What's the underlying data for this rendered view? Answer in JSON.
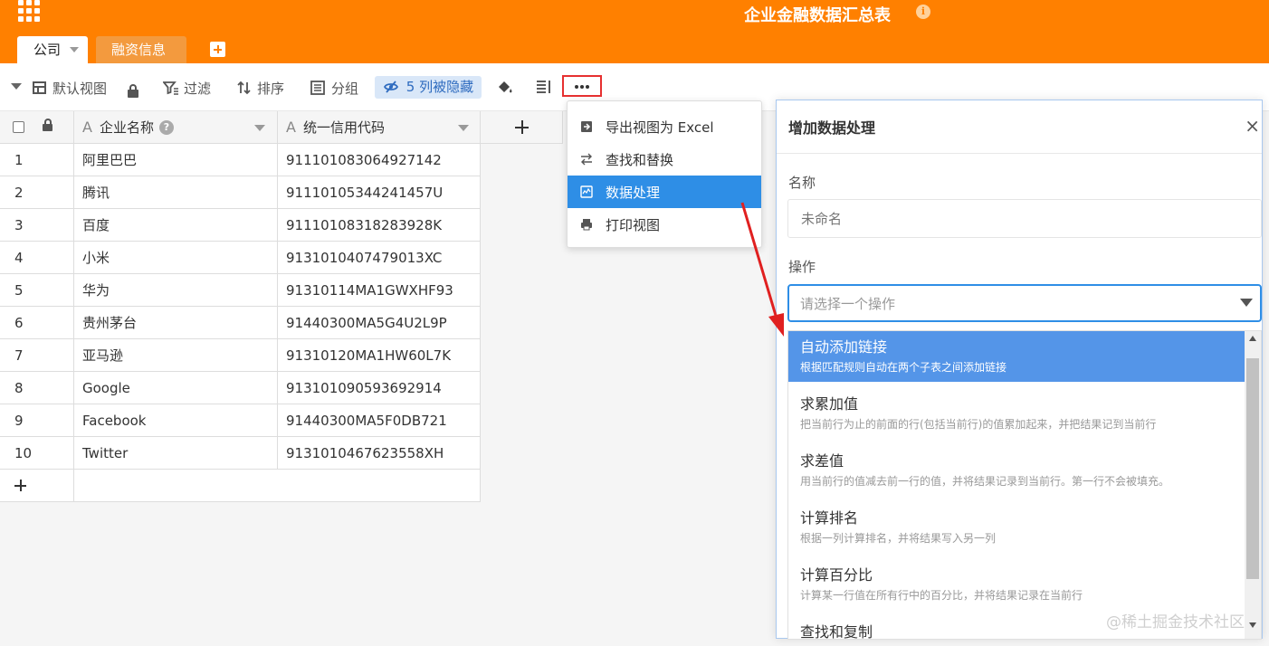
{
  "app": {
    "title": "企业金融数据汇总表",
    "info_icon": "i",
    "accent_color": "#ff8000"
  },
  "tabs": [
    {
      "label": "公司",
      "active": true
    },
    {
      "label": "融资信息",
      "active": false
    }
  ],
  "toolbar": {
    "view": "默认视图",
    "filter": "过滤",
    "sort": "排序",
    "group": "分组",
    "hidden_columns": "5 列被隐藏"
  },
  "table": {
    "columns": [
      {
        "name": "企业名称",
        "icon": "text-icon"
      },
      {
        "name": "统一信用代码",
        "icon": "text-icon"
      }
    ],
    "rows": [
      {
        "idx": "1",
        "name": "阿里巴巴",
        "code": "91110108306492714​2"
      },
      {
        "idx": "2",
        "name": "腾讯",
        "code": "91110105344241457U"
      },
      {
        "idx": "3",
        "name": "百度",
        "code": "91110108318283928K"
      },
      {
        "idx": "4",
        "name": "小米",
        "code": "9131010407479013XC"
      },
      {
        "idx": "5",
        "name": "华为",
        "code": "91310114MA1GWXHF93"
      },
      {
        "idx": "6",
        "name": "贵州茅台",
        "code": "91440300MA5G4U2L9P"
      },
      {
        "idx": "7",
        "name": "亚马逊",
        "code": "91310120MA1HW60L7K"
      },
      {
        "idx": "8",
        "name": "Google",
        "code": "913101090593692914"
      },
      {
        "idx": "9",
        "name": "Facebook",
        "code": "91440300MA5F0DB721"
      },
      {
        "idx": "10",
        "name": "Twitter",
        "code": "9131010467623558XH"
      }
    ]
  },
  "menu": {
    "items": [
      {
        "label": "导出视图为 Excel",
        "icon": "export-icon"
      },
      {
        "label": "查找和替换",
        "icon": "swap-icon"
      },
      {
        "label": "数据处理",
        "icon": "chart-icon",
        "selected": true
      },
      {
        "label": "打印视图",
        "icon": "print-icon"
      }
    ]
  },
  "panel": {
    "title": "增加数据处理",
    "close": "×",
    "name_label": "名称",
    "name_placeholder": "未命名",
    "op_label": "操作",
    "op_placeholder": "请选择一个操作",
    "options": [
      {
        "title": "自动添加链接",
        "desc": "根据匹配规则自动在两个子表之间添加链接",
        "highlighted": true
      },
      {
        "title": "求累加值",
        "desc": "把当前行为止的前面的行(包括当前行)的值累加起来，并把结果记到当前行"
      },
      {
        "title": "求差值",
        "desc": "用当前行的值减去前一行的值，并将结果记录到当前行。第一行不会被填充。"
      },
      {
        "title": "计算排名",
        "desc": "根据一列计算排名，并将结果写入另一列"
      },
      {
        "title": "计算百分比",
        "desc": "计算某一行值在所有行中的百分比，并将结果记录在当前行"
      },
      {
        "title": "查找和复制",
        "desc": ""
      }
    ]
  },
  "watermark": "@稀土掘金技术社区"
}
